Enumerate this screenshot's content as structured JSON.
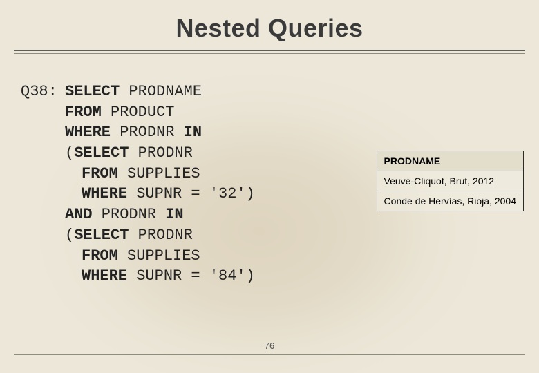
{
  "title": "Nested Queries",
  "page_number": "76",
  "query": {
    "label": "Q38:",
    "line1_kw1": "SELECT",
    "line1_col": " PRODNAME",
    "line2_kw1": "FROM",
    "line2_tbl": " PRODUCT",
    "line3_kw1": "WHERE",
    "line3_txt1": " PRODNR ",
    "line3_kw2": "IN",
    "line4_open": "(",
    "line4_kw1": "SELECT",
    "line4_col": " PRODNR",
    "line5_kw1": "FROM",
    "line5_tbl": " SUPPLIES",
    "line6_kw1": "WHERE",
    "line6_txt": " SUPNR = '32')",
    "line7_kw1": "AND",
    "line7_txt1": " PRODNR ",
    "line7_kw2": "IN",
    "line8_open": "(",
    "line8_kw1": "SELECT",
    "line8_col": " PRODNR",
    "line9_kw1": "FROM",
    "line9_tbl": " SUPPLIES",
    "line10_kw1": "WHERE",
    "line10_txt": " SUPNR = '84')"
  },
  "result": {
    "header": "PRODNAME",
    "rows": [
      "Veuve-Cliquot, Brut, 2012",
      "Conde de Hervías, Rioja, 2004"
    ]
  }
}
